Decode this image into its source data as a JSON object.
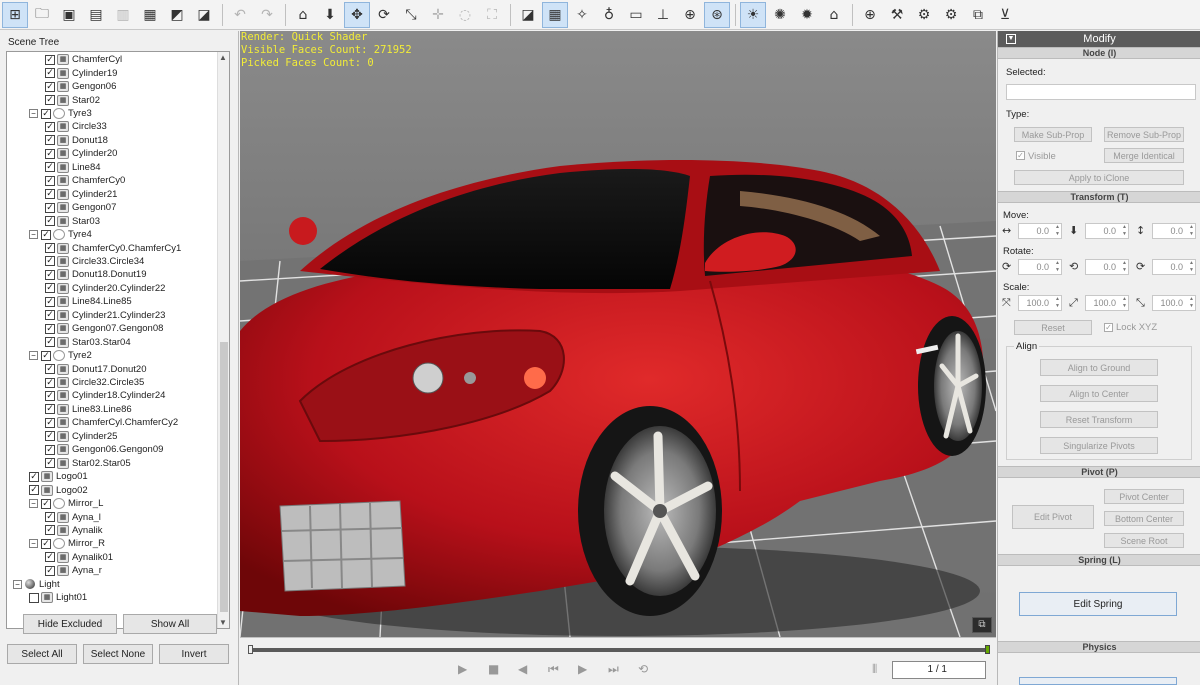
{
  "toolbar": {
    "groups": [
      [
        {
          "icon": "scene-tree-icon",
          "glyph": "⊞",
          "active": true
        },
        {
          "icon": "open-folder-icon",
          "glyph": "🗀"
        },
        {
          "icon": "save-icon",
          "glyph": "▣"
        },
        {
          "icon": "export-fbx-icon",
          "glyph": "▤"
        },
        {
          "icon": "export-obj-icon",
          "glyph": "▥",
          "dim": true
        },
        {
          "icon": "export-skp-icon",
          "glyph": "▦"
        },
        {
          "icon": "import-icon",
          "glyph": "◩"
        },
        {
          "icon": "export-image-icon",
          "glyph": "◪"
        }
      ],
      [
        {
          "icon": "undo-icon",
          "glyph": "↶",
          "dim": true
        },
        {
          "icon": "redo-icon",
          "glyph": "↷",
          "dim": true
        }
      ],
      [
        {
          "icon": "home-icon",
          "glyph": "⌂"
        },
        {
          "icon": "select-icon",
          "glyph": "⬇"
        },
        {
          "icon": "move-icon",
          "glyph": "✥",
          "active": true
        },
        {
          "icon": "rotate-icon",
          "glyph": "⟳"
        },
        {
          "icon": "scale-icon",
          "glyph": "⤡"
        },
        {
          "icon": "pan-icon",
          "glyph": "✛",
          "dim": true
        },
        {
          "icon": "orbit-icon",
          "glyph": "◌",
          "dim": true
        },
        {
          "icon": "zoom-extent-icon",
          "glyph": "⛶",
          "dim": true
        }
      ],
      [
        {
          "icon": "wireframe-icon",
          "glyph": "◪"
        },
        {
          "icon": "grid-icon",
          "glyph": "▦",
          "active": true
        },
        {
          "icon": "bone-icon",
          "glyph": "✧"
        },
        {
          "icon": "spot-light-icon",
          "glyph": "♁"
        },
        {
          "icon": "box-icon",
          "glyph": "▭"
        },
        {
          "icon": "ground-icon",
          "glyph": "⊥"
        },
        {
          "icon": "globe-wire-icon",
          "glyph": "⊕"
        },
        {
          "icon": "focus-icon",
          "glyph": "⊛",
          "active": true
        }
      ],
      [
        {
          "icon": "sun-light-icon",
          "glyph": "☀",
          "active": true
        },
        {
          "icon": "point-light-icon",
          "glyph": "✺"
        },
        {
          "icon": "dir-light-icon",
          "glyph": "✹"
        },
        {
          "icon": "museum-icon",
          "glyph": "⌂"
        }
      ],
      [
        {
          "icon": "web-icon",
          "glyph": "⊕"
        },
        {
          "icon": "wrench-icon",
          "glyph": "⚒"
        },
        {
          "icon": "settings-page-icon",
          "glyph": "⚙"
        },
        {
          "icon": "settings-image-icon",
          "glyph": "⚙"
        },
        {
          "icon": "copy-icon",
          "glyph": "⧉"
        },
        {
          "icon": "cart-icon",
          "glyph": "⊻"
        }
      ]
    ]
  },
  "scene_tree": {
    "title": "Scene Tree",
    "rows": [
      {
        "label": "ChamferCyl",
        "level": 2
      },
      {
        "label": "Cylinder19",
        "level": 2
      },
      {
        "label": "Gengon06",
        "level": 2
      },
      {
        "label": "Star02",
        "level": 2
      },
      {
        "label": "Tyre3",
        "level": 1,
        "group": true
      },
      {
        "label": "Circle33",
        "level": 2
      },
      {
        "label": "Donut18",
        "level": 2
      },
      {
        "label": "Cylinder20",
        "level": 2
      },
      {
        "label": "Line84",
        "level": 2
      },
      {
        "label": "ChamferCy0",
        "level": 2
      },
      {
        "label": "Cylinder21",
        "level": 2
      },
      {
        "label": "Gengon07",
        "level": 2
      },
      {
        "label": "Star03",
        "level": 2
      },
      {
        "label": "Tyre4",
        "level": 1,
        "group": true
      },
      {
        "label": "ChamferCy0.ChamferCy1",
        "level": 2
      },
      {
        "label": "Circle33.Circle34",
        "level": 2
      },
      {
        "label": "Donut18.Donut19",
        "level": 2
      },
      {
        "label": "Cylinder20.Cylinder22",
        "level": 2
      },
      {
        "label": "Line84.Line85",
        "level": 2
      },
      {
        "label": "Cylinder21.Cylinder23",
        "level": 2
      },
      {
        "label": "Gengon07.Gengon08",
        "level": 2
      },
      {
        "label": "Star03.Star04",
        "level": 2
      },
      {
        "label": "Tyre2",
        "level": 1,
        "group": true
      },
      {
        "label": "Donut17.Donut20",
        "level": 2
      },
      {
        "label": "Circle32.Circle35",
        "level": 2
      },
      {
        "label": "Cylinder18.Cylinder24",
        "level": 2
      },
      {
        "label": "Line83.Line86",
        "level": 2
      },
      {
        "label": "ChamferCyl.ChamferCy2",
        "level": 2
      },
      {
        "label": "Cylinder25",
        "level": 2
      },
      {
        "label": "Gengon06.Gengon09",
        "level": 2
      },
      {
        "label": "Star02.Star05",
        "level": 2
      },
      {
        "label": "Logo01",
        "level": 1
      },
      {
        "label": "Logo02",
        "level": 1
      },
      {
        "label": "Mirror_L",
        "level": 1,
        "group": true
      },
      {
        "label": "Ayna_l",
        "level": 2
      },
      {
        "label": "Aynalik",
        "level": 2
      },
      {
        "label": "Mirror_R",
        "level": 1,
        "group": true
      },
      {
        "label": "Aynalik01",
        "level": 2
      },
      {
        "label": "Ayna_r",
        "level": 2
      },
      {
        "label": "Light",
        "level": 0,
        "light": true
      },
      {
        "label": "Light01",
        "level": 1,
        "partial": true
      }
    ],
    "buttons": {
      "hide_excluded": "Hide Excluded",
      "show_all": "Show All",
      "select_all": "Select All",
      "select_none": "Select None",
      "invert": "Invert"
    }
  },
  "viewport": {
    "render": "Render: Quick Shader",
    "visible_faces": "Visible Faces Count: 271952",
    "picked_faces": "Picked Faces Count: 0",
    "colors": {
      "background": "#6f6f6f",
      "car_body": "#c41216",
      "grid": "#e6e6e6"
    }
  },
  "timeline": {
    "frame": "1 / 1"
  },
  "modify": {
    "title": "Modify",
    "node": {
      "header": "Node (I)",
      "selected_label": "Selected:",
      "type_label": "Type:",
      "make_sub_prop": "Make Sub-Prop",
      "remove_sub_prop": "Remove Sub-Prop",
      "visible": "Visible",
      "merge_identical": "Merge Identical",
      "apply_iclone": "Apply to iClone"
    },
    "transform": {
      "header": "Transform (T)",
      "move_label": "Move:",
      "rotate_label": "Rotate:",
      "scale_label": "Scale:",
      "move": [
        "0.0",
        "0.0",
        "0.0"
      ],
      "rotate": [
        "0.0",
        "0.0",
        "0.0"
      ],
      "scale": [
        "100.0",
        "100.0",
        "100.0"
      ],
      "reset": "Reset",
      "lock_xyz": "Lock XYZ",
      "align_label": "Align",
      "align_ground": "Align to Ground",
      "align_center": "Align to Center",
      "reset_transform": "Reset Transform",
      "singularize": "Singularize Pivots"
    },
    "pivot": {
      "header": "Pivot (P)",
      "edit_pivot": "Edit Pivot",
      "pivot_center": "Pivot Center",
      "bottom_center": "Bottom Center",
      "scene_root": "Scene Root"
    },
    "spring": {
      "header": "Spring (L)",
      "edit_spring": "Edit Spring"
    },
    "physics": {
      "header": "Physics"
    }
  }
}
